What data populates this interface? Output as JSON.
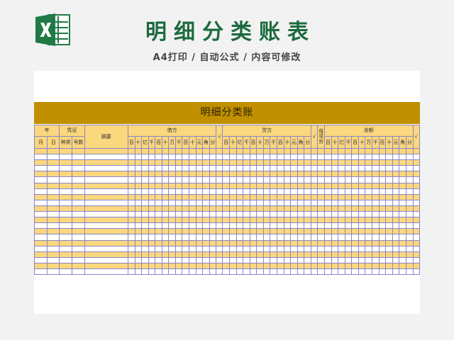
{
  "header": {
    "title": "明细分类账表",
    "subtitle": "A4打印 / 自动公式 / 内容可修改"
  },
  "sheet": {
    "banner": "明细分类账"
  },
  "columns": {
    "year": "年",
    "month": "月",
    "day": "日",
    "voucher": "凭证",
    "voucher_type": "种类",
    "voucher_no": "号数",
    "summary": "摘要",
    "debit": "借方",
    "credit": "贷方",
    "check": "√",
    "dc": "借或贷",
    "balance": "余额",
    "digits": [
      "百",
      "十",
      "亿",
      "千",
      "百",
      "十",
      "万",
      "千",
      "百",
      "十",
      "元",
      "角",
      "分"
    ]
  },
  "colors": {
    "title_green": "#1d6a3e",
    "banner_gold": "#c09000",
    "row_stripe": "#fbd77d",
    "grid_line": "#8a86c8"
  },
  "body_rows": 22
}
